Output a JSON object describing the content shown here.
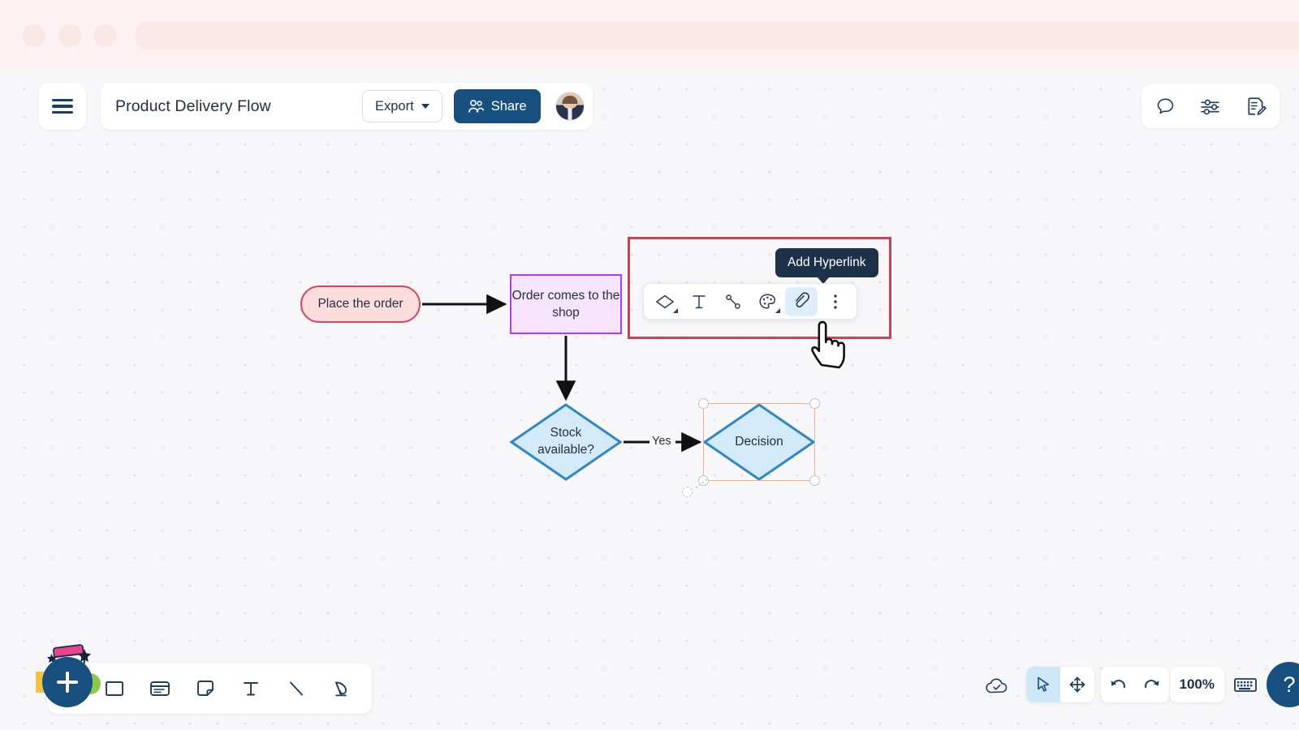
{
  "browser": {
    "dots": [
      "window-dot",
      "window-dot",
      "window-dot"
    ],
    "urlbar_value": ""
  },
  "header": {
    "menu_icon": "hamburger-icon",
    "title": "Product Delivery Flow",
    "export_label": "Export",
    "export_caret_icon": "chevron-down-icon",
    "share_label": "Share",
    "share_icon": "people-icon",
    "avatar_icon": "user-avatar"
  },
  "top_right_tools": [
    {
      "name": "comments",
      "icon": "comment-bubble-icon"
    },
    {
      "name": "settings",
      "icon": "sliders-icon"
    },
    {
      "name": "notes",
      "icon": "edit-document-icon"
    }
  ],
  "diagram": {
    "shapes": [
      {
        "id": "place-order",
        "label": "Place the order",
        "type": "rounded",
        "fill": "#fcdcdc",
        "stroke": "#d9465a"
      },
      {
        "id": "order-shop",
        "label": "Order comes to the shop",
        "type": "rectangle",
        "fill": "#f6e4fd",
        "stroke": "#b43bee"
      },
      {
        "id": "stock-available",
        "label": "Stock available?",
        "type": "diamond",
        "fill": "#d3eafb",
        "stroke": "#2f86c8"
      },
      {
        "id": "decision",
        "label": "Decision",
        "type": "diamond",
        "fill": "#d3eafb",
        "stroke": "#2f86c8"
      }
    ],
    "edge_labels": [
      {
        "id": "yes",
        "text": "Yes"
      }
    ],
    "selection": {
      "target": "decision",
      "frame_color": "#f4b183",
      "handles": [
        "top-left",
        "top-right",
        "bottom-left",
        "bottom-right"
      ],
      "rotate_handle": true
    }
  },
  "annotation": {
    "color": "#cf4055"
  },
  "tooltip": {
    "text": "Add Hyperlink",
    "background": "#1d3148"
  },
  "shape_toolbar": {
    "buttons": [
      {
        "name": "change-shape",
        "icon": "diamond-shape-icon",
        "has_caret": true,
        "active": false
      },
      {
        "name": "text-format",
        "icon": "text-icon",
        "has_caret": false,
        "active": false
      },
      {
        "name": "connector",
        "icon": "connector-line-icon",
        "has_caret": false,
        "active": false
      },
      {
        "name": "color-palette",
        "icon": "palette-icon",
        "has_caret": true,
        "active": false
      },
      {
        "name": "add-hyperlink",
        "icon": "link-icon",
        "has_caret": false,
        "active": true
      },
      {
        "name": "more-options",
        "icon": "three-dots-vertical-icon",
        "has_caret": false,
        "active": false
      }
    ]
  },
  "cursor": {
    "icon": "pointing-hand-cursor"
  },
  "bottom_left_toolbar": {
    "add_label": "+",
    "add_icon": "plus-icon",
    "tools": [
      {
        "name": "rectangle-tool",
        "icon": "rectangle-icon"
      },
      {
        "name": "card-tool",
        "icon": "card-icon"
      },
      {
        "name": "sticky-note-tool",
        "icon": "sticky-note-icon"
      },
      {
        "name": "text-tool",
        "icon": "text-icon"
      },
      {
        "name": "line-tool",
        "icon": "line-icon"
      },
      {
        "name": "pen-tool",
        "icon": "pen-icon"
      }
    ]
  },
  "bottom_right_controls": {
    "cloud_status_icon": "cloud-saved-icon",
    "modes": [
      {
        "name": "select-mode",
        "icon": "cursor-arrow-icon",
        "active": true
      },
      {
        "name": "pan-mode",
        "icon": "move-arrows-icon",
        "active": false
      }
    ],
    "history": [
      {
        "name": "undo",
        "icon": "undo-arrow-icon"
      },
      {
        "name": "redo",
        "icon": "redo-arrow-icon"
      }
    ],
    "zoom_level": "100%",
    "keyboard_icon": "keyboard-icon",
    "help_label": "?"
  }
}
